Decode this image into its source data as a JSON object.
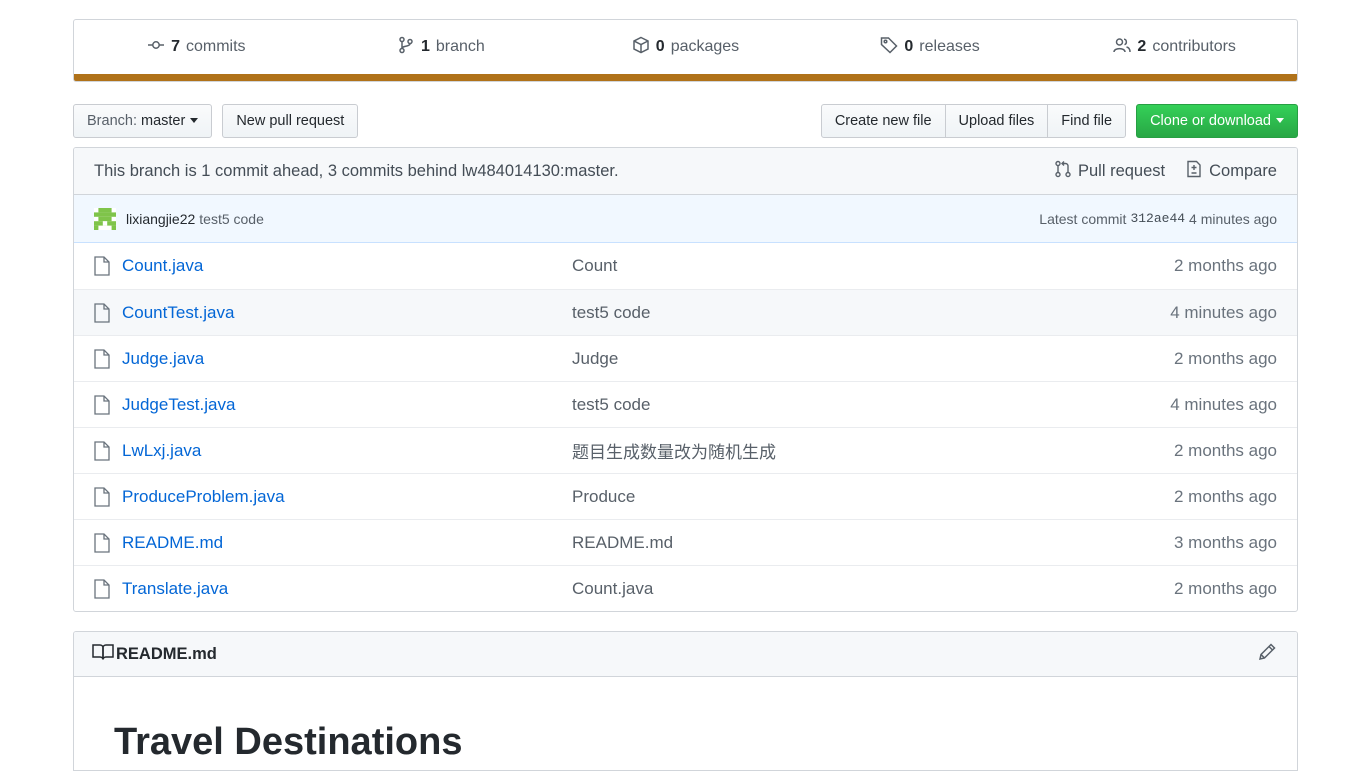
{
  "summary": {
    "commits": {
      "count": "7",
      "label": "commits"
    },
    "branches": {
      "count": "1",
      "label": "branch"
    },
    "packages": {
      "count": "0",
      "label": "packages"
    },
    "releases": {
      "count": "0",
      "label": "releases"
    },
    "contributors": {
      "count": "2",
      "label": "contributors"
    },
    "language_color": "#b07219"
  },
  "toolbar": {
    "branch_prefix": "Branch:",
    "branch_name": "master",
    "new_pull_request": "New pull request",
    "create_new_file": "Create new file",
    "upload_files": "Upload files",
    "find_file": "Find file",
    "clone_or_download": "Clone or download"
  },
  "branch_info": {
    "text": "This branch is 1 commit ahead, 3 commits behind lw484014130:master.",
    "pull_request": "Pull request",
    "compare": "Compare"
  },
  "latest_commit": {
    "author": "lixiangjie22",
    "message": "test5 code",
    "prefix": "Latest commit",
    "sha": "312ae44",
    "age": "4 minutes ago"
  },
  "files": [
    {
      "name": "Count.java",
      "message": "Count",
      "age": "2 months ago"
    },
    {
      "name": "CountTest.java",
      "message": "test5 code",
      "age": "4 minutes ago"
    },
    {
      "name": "Judge.java",
      "message": "Judge",
      "age": "2 months ago"
    },
    {
      "name": "JudgeTest.java",
      "message": "test5 code",
      "age": "4 minutes ago"
    },
    {
      "name": "LwLxj.java",
      "message": "题目生成数量改为随机生成",
      "age": "2 months ago"
    },
    {
      "name": "ProduceProblem.java",
      "message": "Produce",
      "age": "2 months ago"
    },
    {
      "name": "README.md",
      "message": "README.md",
      "age": "3 months ago"
    },
    {
      "name": "Translate.java",
      "message": "Count.java",
      "age": "2 months ago"
    }
  ],
  "readme": {
    "filename": "README.md",
    "heading": "Travel Destinations"
  }
}
